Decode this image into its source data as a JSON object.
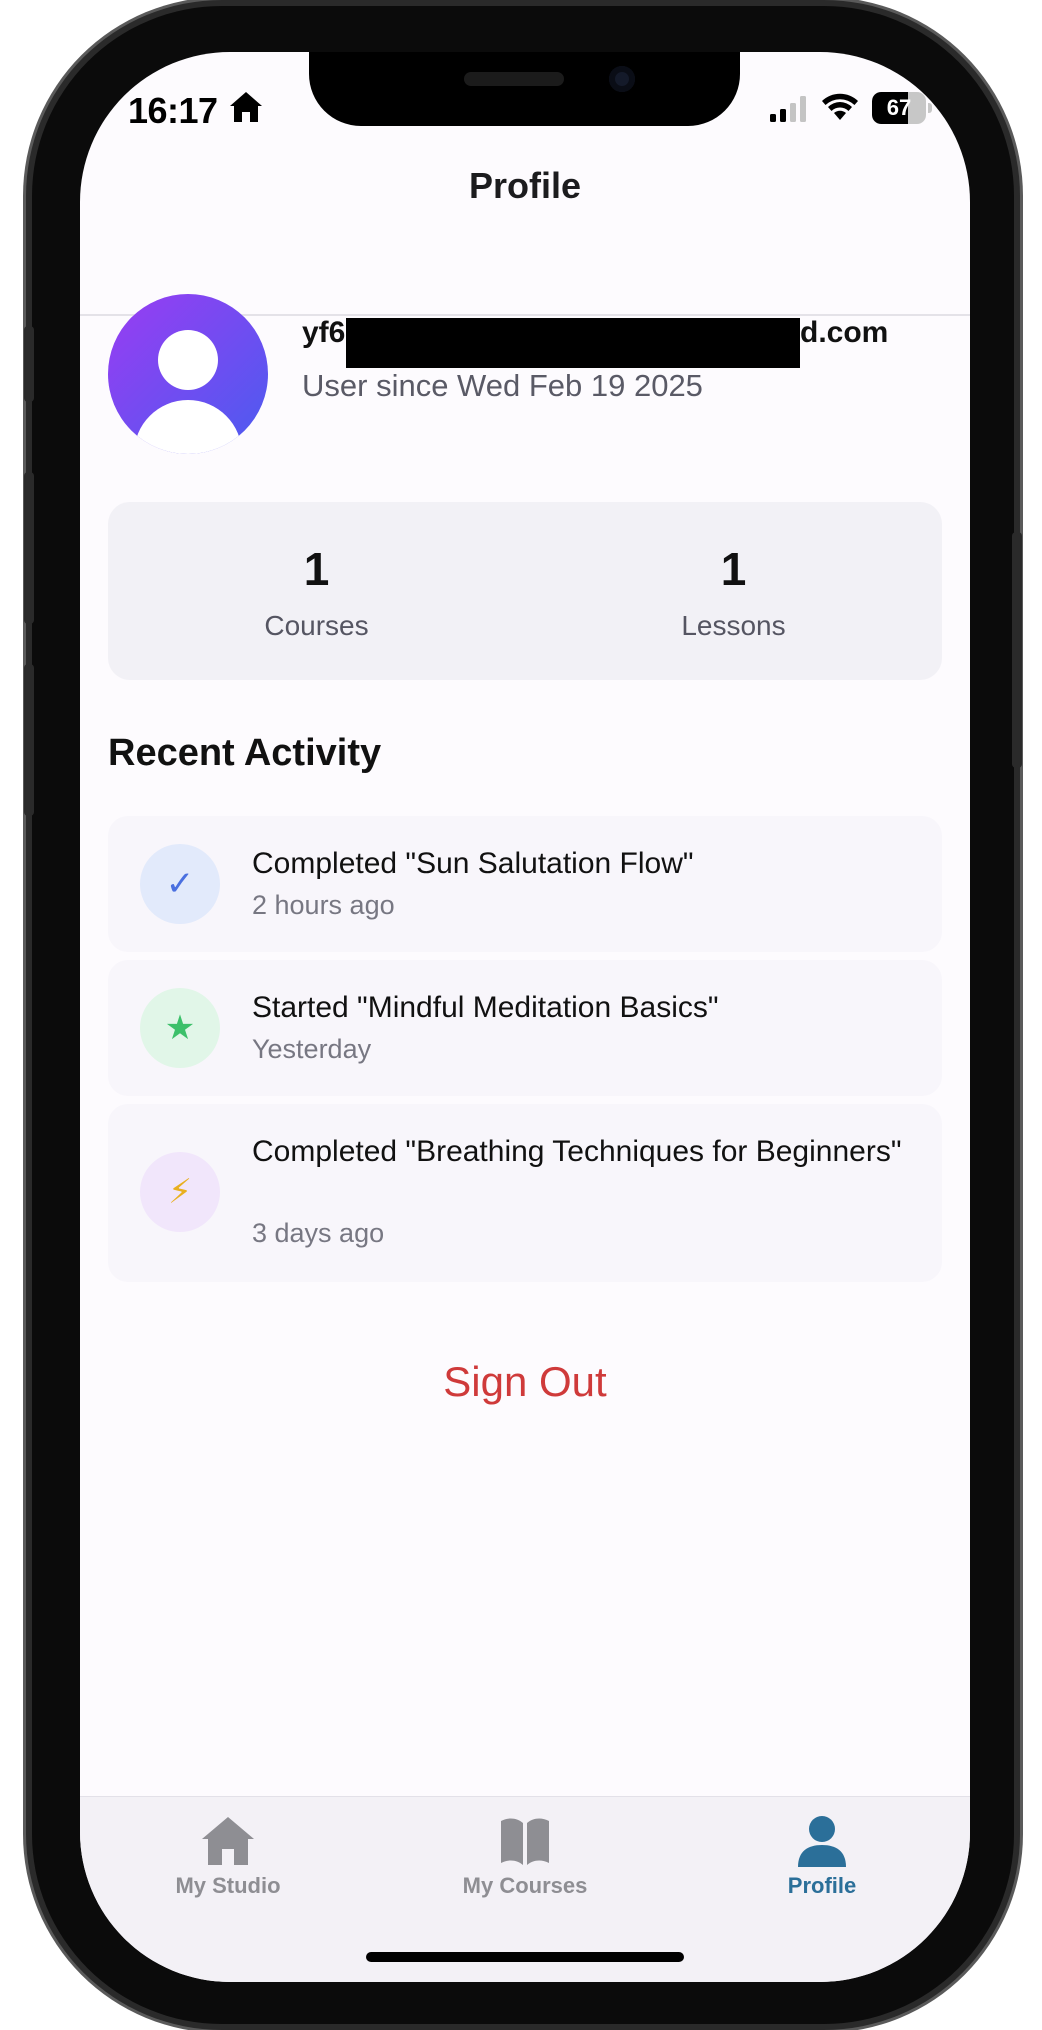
{
  "status_bar": {
    "time": "16:17",
    "battery": "67",
    "battery_level": 0.67
  },
  "header": {
    "title": "Profile"
  },
  "profile": {
    "email_prefix": "yf6",
    "email_suffix": "d.com",
    "user_since": "User since Wed Feb 19 2025"
  },
  "stats": [
    {
      "value": "1",
      "label": "Courses"
    },
    {
      "value": "1",
      "label": "Lessons"
    }
  ],
  "recent_activity": {
    "title": "Recent Activity",
    "items": [
      {
        "title": "Completed \"Sun Salutation Flow\"",
        "time": "2 hours ago",
        "icon": "check-icon",
        "glyph": "✓",
        "icon_color": "#4a70e0",
        "icon_bg": "#e2eafb"
      },
      {
        "title": "Started \"Mindful Meditation Basics\"",
        "time": "Yesterday",
        "icon": "star-icon",
        "glyph": "★",
        "icon_color": "#3cc06a",
        "icon_bg": "#e1f6e8"
      },
      {
        "title": "Completed \"Breathing Techniques for Beginners\"",
        "time": "3 days ago",
        "icon": "lightning-icon",
        "glyph": "⚡",
        "icon_color": "#e8b020",
        "icon_bg": "#f1e6fb"
      }
    ]
  },
  "sign_out": {
    "label": "Sign Out",
    "color": "#cf3a3a"
  },
  "tab_bar": {
    "active_color": "#2b6f99",
    "inactive_color": "#8e8e93",
    "tabs": [
      {
        "label": "My Studio",
        "icon": "house-icon",
        "active": false
      },
      {
        "label": "My Courses",
        "icon": "book-icon",
        "active": false
      },
      {
        "label": "Profile",
        "icon": "person-icon",
        "active": true
      }
    ]
  }
}
